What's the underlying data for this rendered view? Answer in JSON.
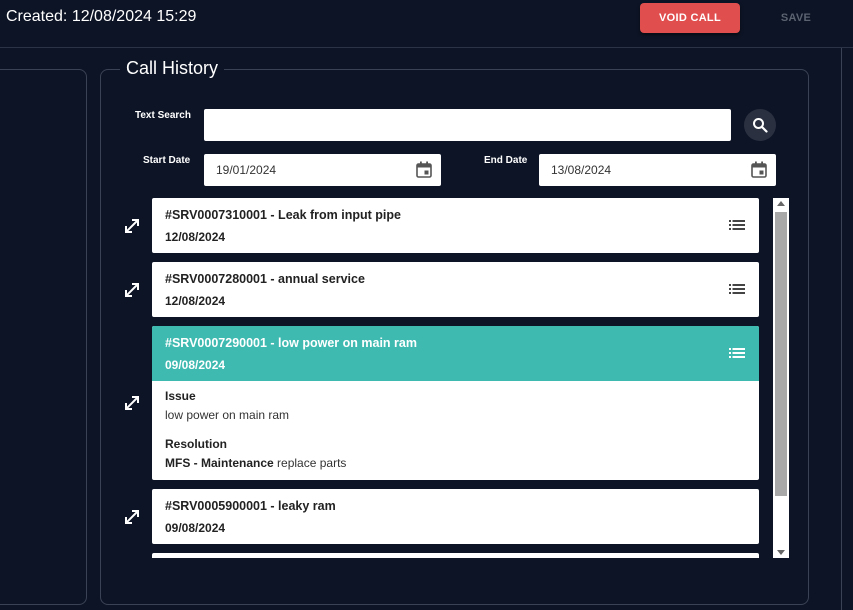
{
  "header": {
    "created": "Created: 12/08/2024 15:29",
    "void_label": "VOID CALL",
    "save_label": "SAVE"
  },
  "history": {
    "title": "Call History",
    "text_search_label": "Text Search",
    "text_search_value": "",
    "start_date_label": "Start Date",
    "start_date_value": "19/01/2024",
    "end_date_label": "End Date",
    "end_date_value": "13/08/2024",
    "calls": [
      {
        "title": "#SRV0007310001 - Leak from input pipe",
        "date": "12/08/2024"
      },
      {
        "title": "#SRV0007280001 - annual service",
        "date": "12/08/2024"
      },
      {
        "title": "#SRV0007290001 - low power on main ram",
        "date": "09/08/2024",
        "issue_label": "Issue",
        "issue_value": "low power on main ram",
        "resolution_label": "Resolution",
        "resolution_strong": "MFS - Maintenance",
        "resolution_value": "replace parts"
      },
      {
        "title": "#SRV0005900001 - leaky ram",
        "date": "09/08/2024"
      }
    ]
  },
  "colors": {
    "background": "#0d1425",
    "void_button": "#e04e4e",
    "active_card": "#3fbab1"
  },
  "icons": [
    "search-icon",
    "calendar-icon",
    "expand-icon",
    "list-icon"
  ]
}
